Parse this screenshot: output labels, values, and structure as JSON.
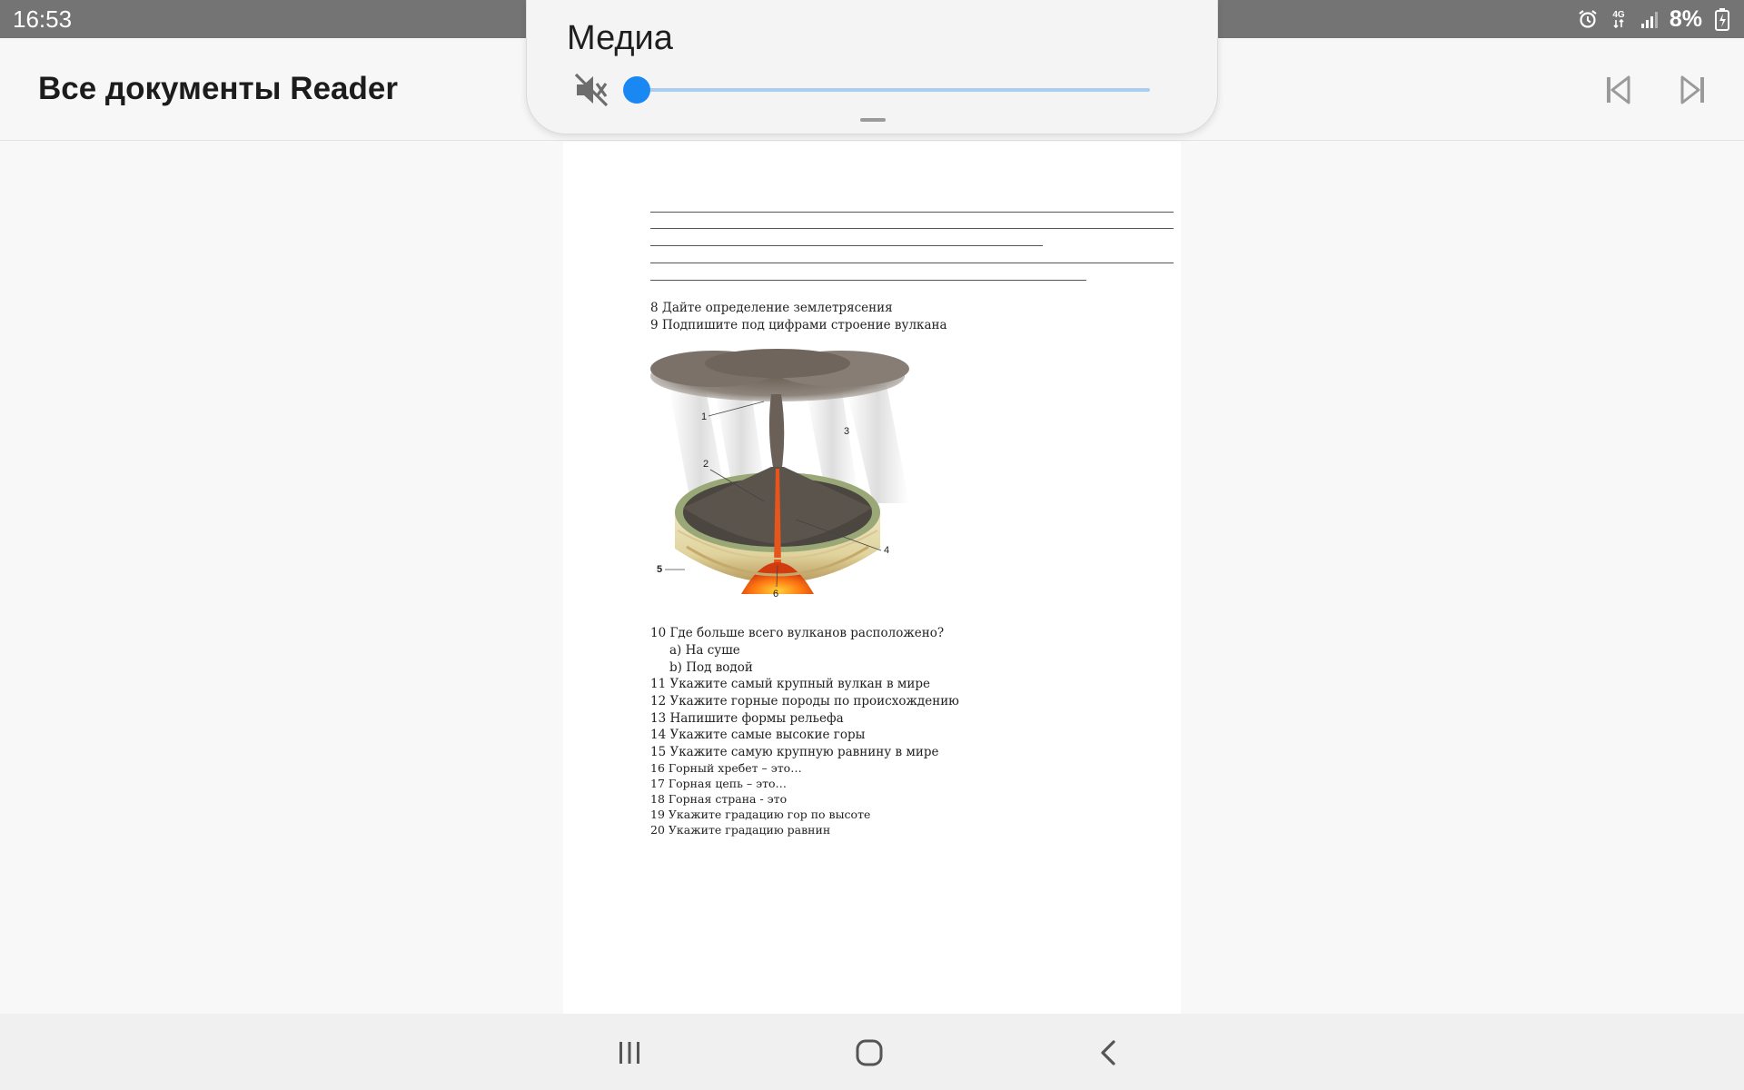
{
  "status_bar": {
    "time": "16:53",
    "network": "4G",
    "battery": "8%",
    "icons": [
      "alarm-icon",
      "4g-data-icon",
      "signal-icon",
      "battery-charging-icon"
    ]
  },
  "app_bar": {
    "title": "Все документы Reader",
    "prev_icon": "skip-previous-icon",
    "next_icon": "skip-next-icon"
  },
  "media_panel": {
    "title": "Медиа",
    "mute_icon": "volume-muted-icon",
    "volume_level": 0,
    "accent_color": "#1a88f2"
  },
  "document": {
    "questions_top": [
      "8 Дайте определение землетрясения",
      "9 Подпишите под цифрами строение вулкана"
    ],
    "figure_labels": [
      "1",
      "2",
      "3",
      "4",
      "5",
      "6"
    ],
    "q10": {
      "question": "10 Где больше всего вулканов расположено?",
      "options": [
        "a)  На суше",
        "b)  Под водой"
      ]
    },
    "questions_mid": [
      "11 Укажите самый крупный вулкан в мире",
      "12 Укажите горные породы по происхождению",
      "13 Напишите формы рельефа",
      "14 Укажите самые высокие горы",
      "15 Укажите самую крупную равнину в мире"
    ],
    "questions_small": [
      "16 Горный хребет – это…",
      "17 Горная цепь – это…",
      "18 Горная страна - это",
      "19 Укажите градацию гор по высоте",
      "20 Укажите градацию равнин"
    ]
  },
  "system_nav": {
    "recents_icon": "recents-icon",
    "home_icon": "home-icon",
    "back_icon": "back-icon"
  }
}
